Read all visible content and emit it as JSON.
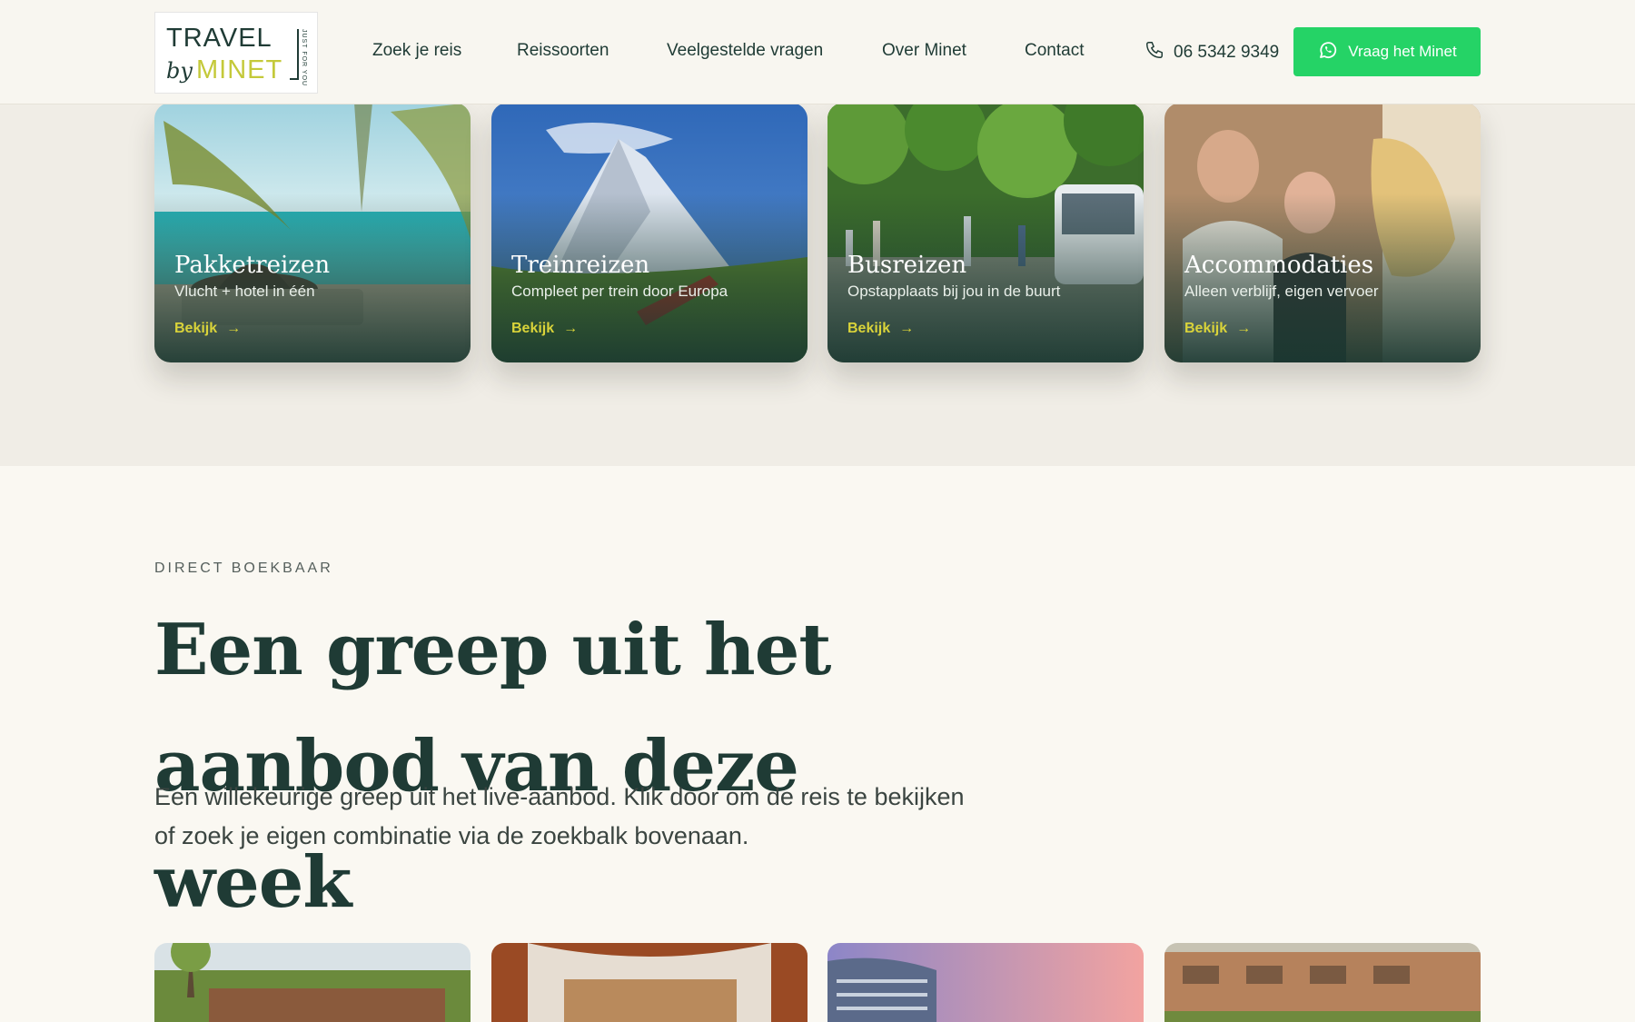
{
  "header": {
    "logo": {
      "line1": "TRAVEL",
      "by": "by",
      "line2": "MINET",
      "tagline": "JUST FOR YOU"
    },
    "nav": [
      {
        "label": "Zoek je reis"
      },
      {
        "label": "Reissoorten"
      },
      {
        "label": "Veelgestelde vragen"
      },
      {
        "label": "Over Minet"
      },
      {
        "label": "Contact"
      }
    ],
    "phone": "06 5342 9349",
    "cta_label": "Vraag het Minet"
  },
  "categories": [
    {
      "title": "Pakketreizen",
      "subtitle": "Vlucht + hotel in één",
      "link": "Bekijk"
    },
    {
      "title": "Treinreizen",
      "subtitle": "Compleet per trein door Europa",
      "link": "Bekijk"
    },
    {
      "title": "Busreizen",
      "subtitle": "Opstapplaats bij jou in de buurt",
      "link": "Bekijk"
    },
    {
      "title": "Accommodaties",
      "subtitle": "Alleen verblijf, eigen vervoer",
      "link": "Bekijk"
    }
  ],
  "offer_section": {
    "eyebrow": "DIRECT BOEKBAAR",
    "heading": "Een greep uit het aanbod van deze week",
    "lead": "Een willekeurige greep uit het live-aanbod. Klik door om de reis te bekijken of zoek je eigen combinatie via de zoekbalk bovenaan."
  },
  "colors": {
    "brand_green": "#1f3b35",
    "accent_lime": "#c4c93a",
    "whatsapp": "#25d366",
    "link_yellow": "#d9d33a"
  }
}
